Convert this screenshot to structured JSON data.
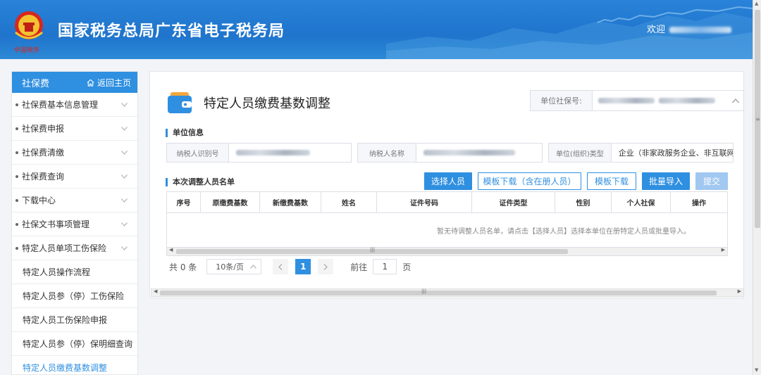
{
  "header": {
    "title": "国家税务总局广东省电子税务局",
    "welcome_label": "欢迎"
  },
  "sidebar": {
    "title": "社保费",
    "home_label": "返回主页",
    "items": [
      {
        "label": "社保费基本信息管理"
      },
      {
        "label": "社保费申报"
      },
      {
        "label": "社保费清缴"
      },
      {
        "label": "社保费查询"
      },
      {
        "label": "下载中心"
      },
      {
        "label": "社保文书事项管理"
      },
      {
        "label": "特定人员单项工伤保险"
      }
    ],
    "subitems": [
      {
        "label": "特定人员操作流程"
      },
      {
        "label": "特定人员参（停）工伤保险"
      },
      {
        "label": "特定人员工伤保险申报"
      },
      {
        "label": "特定人员参（停）保明细查询"
      },
      {
        "label": "特定人员缴费基数调整"
      }
    ]
  },
  "page": {
    "title": "特定人员缴费基数调整",
    "unit_social_label": "单位社保号:",
    "section_unit": "单位信息",
    "taxpayer_id_label": "纳税人识别号",
    "taxpayer_name_label": "纳税人名称",
    "org_type_label": "单位(组织)类型",
    "org_type_value": "企业（非家政服务企业、非互联网",
    "section_list": "本次调整人员名单",
    "buttons": {
      "select": "选择人员",
      "template_registered": "模板下载（含在册人员）",
      "template": "模板下载",
      "batch_import": "批量导入",
      "submit": "提交"
    },
    "columns": [
      "序号",
      "原缴费基数",
      "新缴费基数",
      "姓名",
      "证件号码",
      "证件类型",
      "性别",
      "个人社保",
      "操作"
    ],
    "empty_text": "暂无待调整人员名单，请点击【选择人员】选择本单位在册特定人员或批量导入。",
    "pager": {
      "total": "共 0 条",
      "page_size": "10条/页",
      "current": "1",
      "goto_label": "前往",
      "goto_value": "1",
      "page_suffix": "页"
    }
  },
  "colors": {
    "accent": "#2f8fe0",
    "header": "#1f74cc"
  }
}
